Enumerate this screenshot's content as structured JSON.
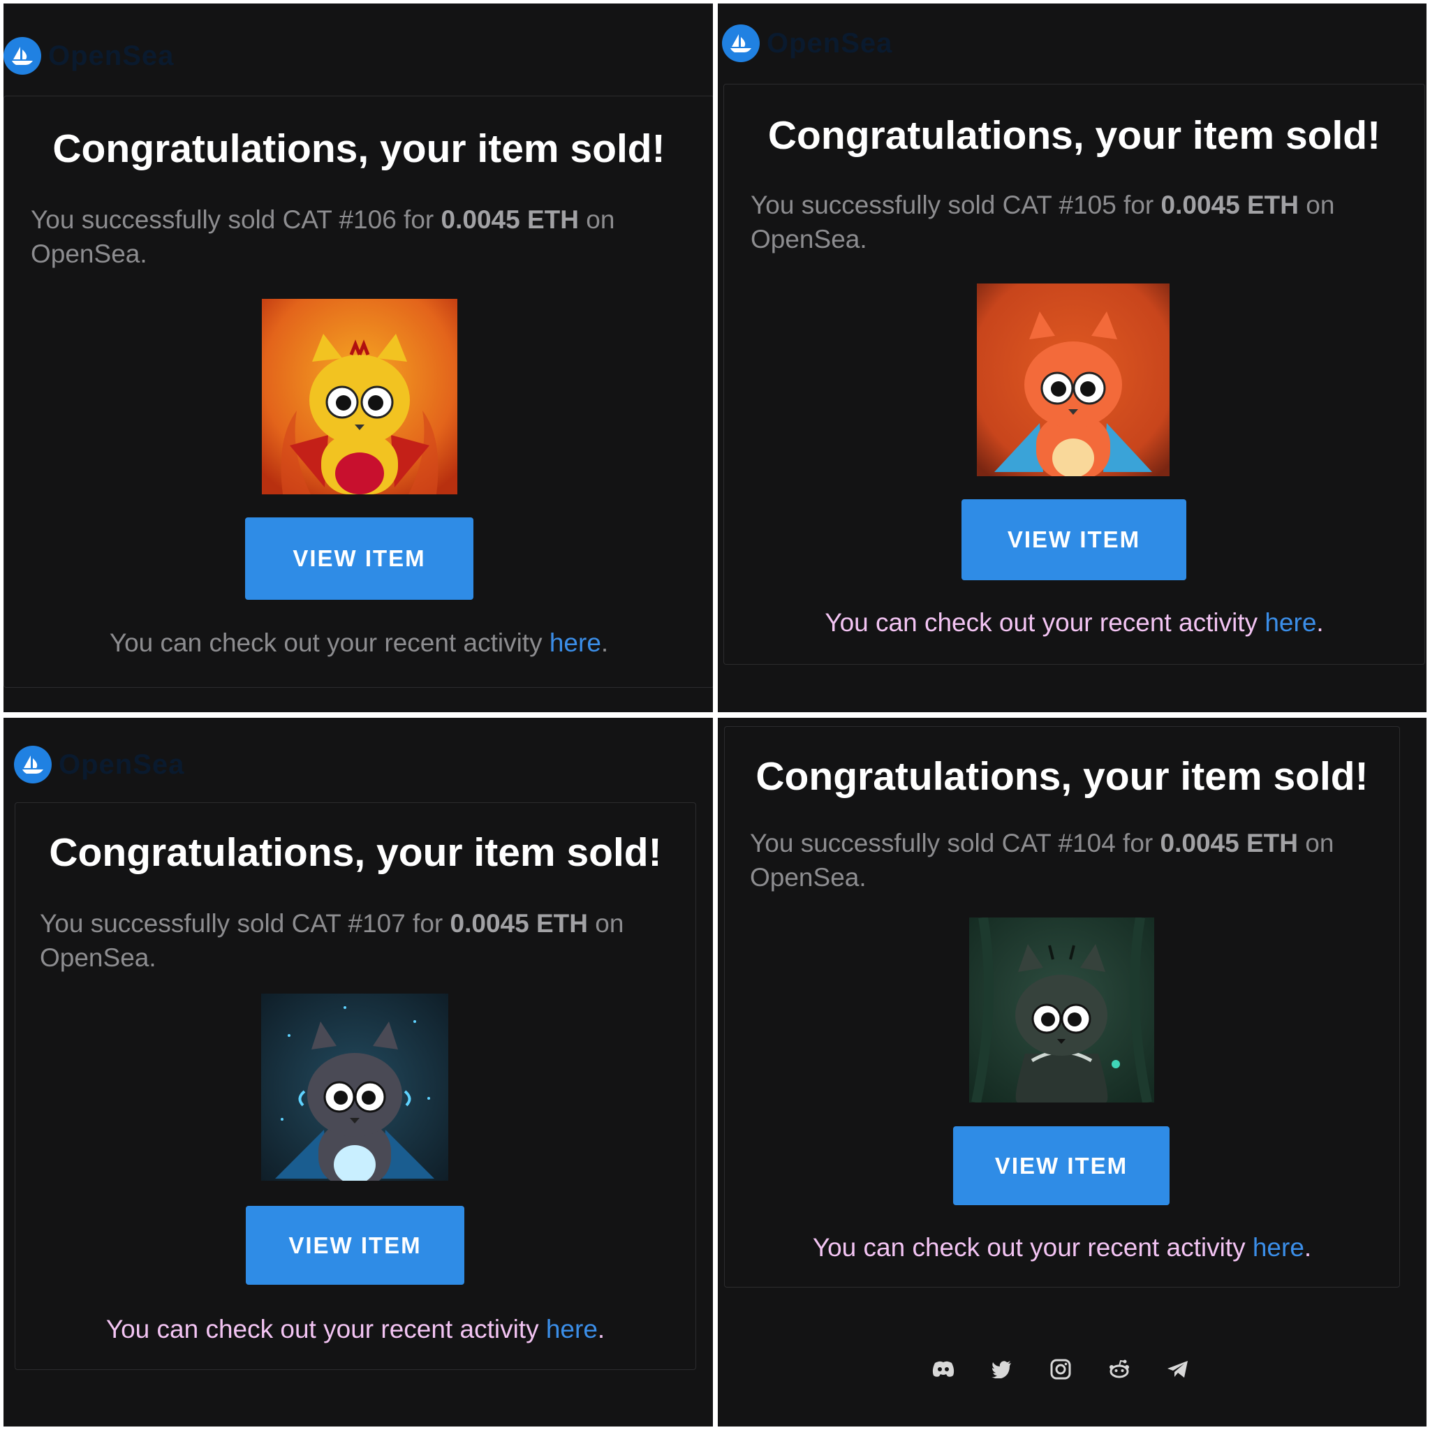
{
  "brand": {
    "name": "OpenSea"
  },
  "title": "Congratulations, your item sold!",
  "panels": [
    {
      "prefix": "You successfully sold CAT #106 for ",
      "price": "0.0045 ETH",
      "suffix": " on OpenSea.",
      "button": "VIEW ITEM",
      "note": "You can check out your recent activity ",
      "link": "here",
      "end": "."
    },
    {
      "prefix": "You successfully sold CAT #105 for ",
      "price": "0.0045 ETH",
      "suffix": " on OpenSea.",
      "button": "VIEW ITEM",
      "note": "You can check out your recent activity ",
      "link": "here",
      "end": "."
    },
    {
      "prefix": "You successfully sold CAT #107 for ",
      "price": "0.0045 ETH",
      "suffix": " on OpenSea.",
      "button": "VIEW ITEM",
      "note": "You can check out your recent activity ",
      "link": "here",
      "end": "."
    },
    {
      "prefix": "You successfully sold CAT #104 for ",
      "price": "0.0045 ETH",
      "suffix": " on OpenSea.",
      "button": "VIEW ITEM",
      "note": "You can check out your recent activity ",
      "link": "here",
      "end": "."
    }
  ],
  "social": [
    "discord-icon",
    "twitter-icon",
    "instagram-icon",
    "reddit-icon",
    "telegram-icon"
  ],
  "colors": {
    "background": "#131314",
    "accent": "#2f8ce6",
    "link": "#3b8ee8"
  }
}
